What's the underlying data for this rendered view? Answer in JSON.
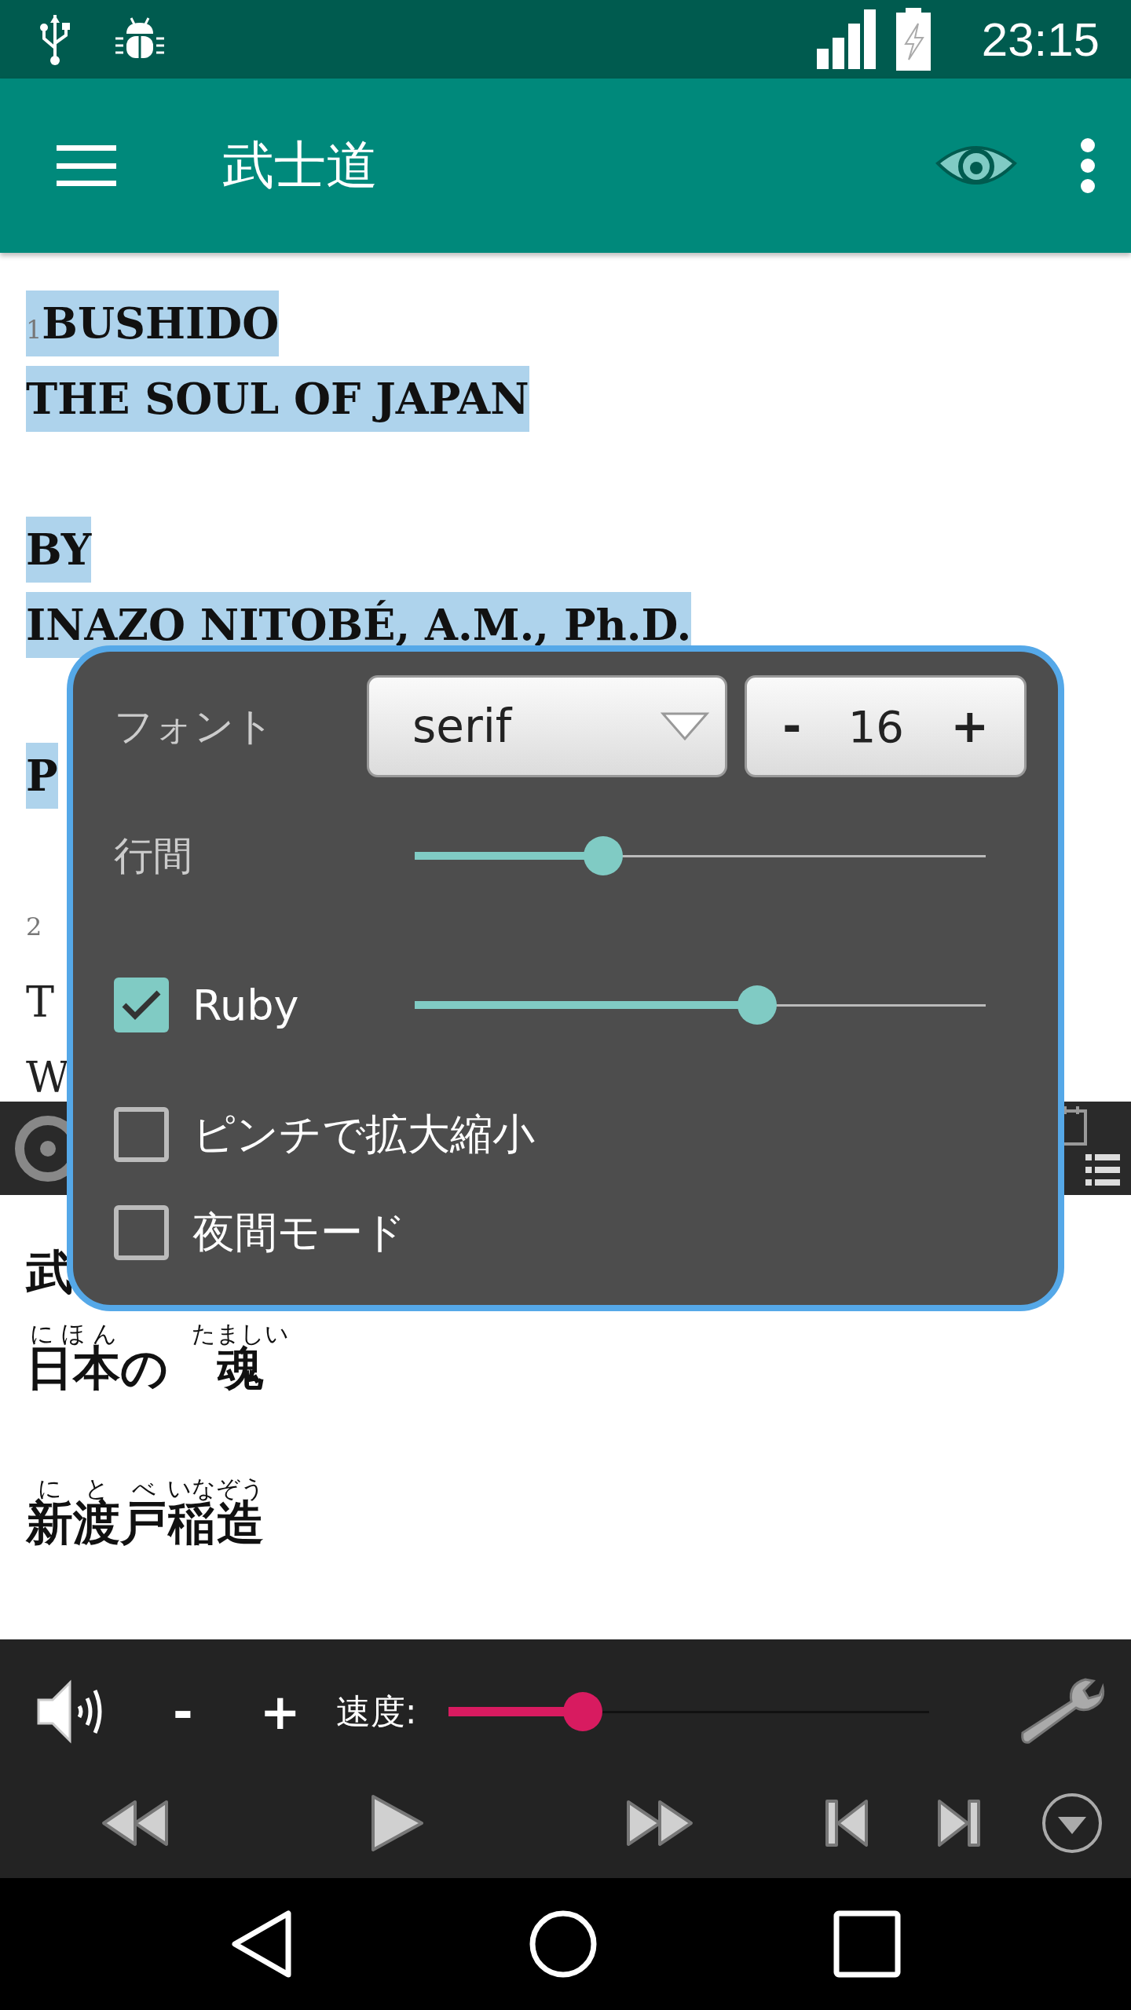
{
  "status_bar": {
    "time": "23:15"
  },
  "app_bar": {
    "title": "武士道"
  },
  "document": {
    "lines": [
      {
        "kind": "heading",
        "marker": "1",
        "text": "BUSHIDO",
        "highlighted": true
      },
      {
        "kind": "heading",
        "text": "THE SOUL OF JAPAN",
        "highlighted": true
      },
      {
        "kind": "gap"
      },
      {
        "kind": "heading",
        "text": "BY",
        "highlighted": true
      },
      {
        "kind": "heading",
        "text": "INAZO NITOBÉ, A.M., Ph.D.",
        "highlighted": true
      },
      {
        "kind": "gap"
      },
      {
        "kind": "heading",
        "text": "P",
        "highlighted": true
      },
      {
        "kind": "gap"
      },
      {
        "kind": "body",
        "marker": "2",
        "highlighted": false
      },
      {
        "kind": "body",
        "text": "T",
        "highlighted": false
      },
      {
        "kind": "body",
        "text": "W",
        "highlighted": false
      }
    ]
  },
  "ruby_text": {
    "lines": [
      {
        "kind": "line",
        "segments": [
          {
            "base": "武"
          }
        ]
      },
      {
        "kind": "line",
        "segments": [
          {
            "base": "日本",
            "ruby": "にほん"
          },
          {
            "base": "の"
          },
          {
            "base": "魂",
            "ruby": "たましい"
          }
        ]
      },
      {
        "kind": "gap"
      },
      {
        "kind": "line",
        "segments": [
          {
            "base": "新渡戸",
            "ruby": "にとべ"
          },
          {
            "base": "稲造",
            "ruby": "いなぞう"
          }
        ]
      }
    ]
  },
  "popup": {
    "font_label": "フォント",
    "font_select": "serif",
    "font_size": {
      "minus": "-",
      "value": "16",
      "plus": "+"
    },
    "rows": [
      {
        "kind": "slider",
        "label": "行間",
        "level": 0.33
      },
      {
        "kind": "checkbox_slider",
        "label": "Ruby",
        "checked": true,
        "level": 0.6
      },
      {
        "kind": "checkbox",
        "label": "ピンチで拡大縮小",
        "checked": false
      },
      {
        "kind": "checkbox",
        "label": "夜間モード",
        "checked": false
      }
    ]
  },
  "player": {
    "volume_minus": "-",
    "volume_plus": "+",
    "speed_label": "速度:",
    "speed": {
      "level": 0.28
    }
  }
}
